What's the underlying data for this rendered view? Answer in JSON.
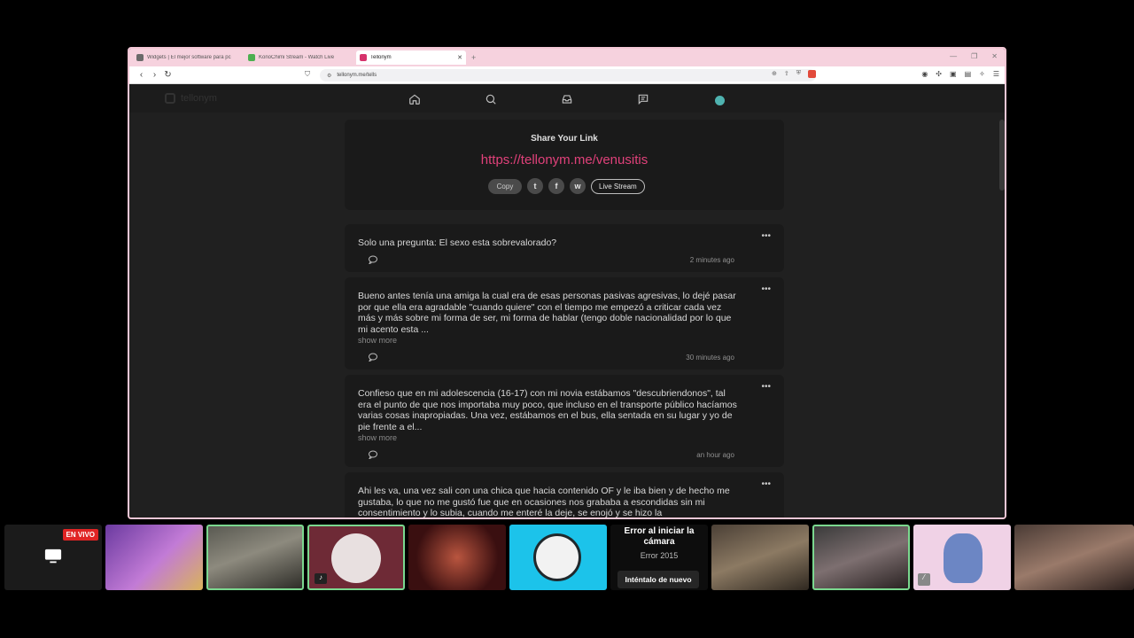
{
  "browser": {
    "tabs": [
      {
        "title": "Widgets | El mejor software para pc",
        "color": "#6a6a6a",
        "active": false
      },
      {
        "title": "KonoChimi Stream - Watch Live",
        "color": "#4caf50",
        "active": false
      },
      {
        "title": "Tellonym",
        "color": "#d6336c",
        "active": true
      }
    ],
    "new_tab": "+",
    "url": "tellonym.me/tells"
  },
  "site": {
    "logo_text": "tellonym"
  },
  "share": {
    "title": "Share Your Link",
    "link": "https://tellonym.me/venusitis",
    "copy_label": "Copy",
    "twitter_glyph": "t",
    "facebook_glyph": "f",
    "whatsapp_glyph": "w",
    "live_label": "Live Stream"
  },
  "tells": [
    {
      "text": "Solo una pregunta: El sexo esta sobrevalorado?",
      "more": "",
      "time": "2 minutes ago",
      "menu": "•••"
    },
    {
      "text": "Bueno antes tenía una amiga la cual era de esas personas pasivas agresivas, lo dejé pasar por que ella era agradable \"cuando quiere\" con el tiempo me empezó a criticar cada vez más y más sobre mi forma de ser, mi forma de hablar (tengo doble nacionalidad por lo que mi acento esta ...",
      "more": "show more",
      "time": "30 minutes ago",
      "menu": "•••"
    },
    {
      "text": "Confieso que en mi adolescencia (16-17) con mi novia estábamos \"descubriendonos\", tal era el punto de que nos importaba muy poco, que incluso en el transporte público hacíamos varias cosas inapropiadas. Una vez, estábamos en el bus, ella sentada en su lugar y yo de pie frente a el...",
      "more": "show more",
      "time": "an hour ago",
      "menu": "•••"
    },
    {
      "text": "Ahi les va, una vez sali con una chica que hacia contenido OF y le iba bien y de hecho me gustaba, lo que no me gustó fue que en ocasiones nos grababa a escondidas sin mi consentimiento y lo subia, cuando me enteré la deje, se enojó y se hizo la",
      "more": "",
      "time": "",
      "menu": "•••"
    }
  ],
  "strip": {
    "live_badge": "EN VIVO",
    "error_title": "Error al iniciar la cámara",
    "error_code": "Error 2015",
    "error_retry": "Inténtalo de nuevo"
  },
  "colors": {
    "accent_link": "#e0417a",
    "tab_bar": "#f6d2de",
    "page_bg": "#202020",
    "card_bg": "#1a1a1a",
    "online_dot": "#4fb3b0"
  }
}
